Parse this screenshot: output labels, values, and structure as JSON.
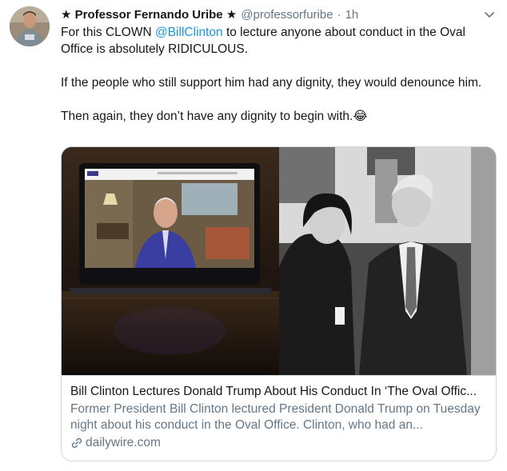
{
  "tweet": {
    "display_name": "★ Professor Fernando Uribe ★",
    "handle": "@professorfuribe",
    "separator": "·",
    "time": "1h",
    "text": {
      "line1_before": "For this CLOWN ",
      "mention": "@BillClinton",
      "line1_after": " to lecture anyone about conduct in the Oval Office is absolutely RIDICULOUS.",
      "paragraph2": "If the people who still support him had any dignity, they would denounce him.",
      "paragraph3": "Then again, they don’t have any dignity to begin with.😂"
    }
  },
  "card": {
    "title": "Bill Clinton Lectures Donald Trump About His Conduct In ‘The Oval Offic...",
    "description": "Former President Bill Clinton lectured President Donald Trump on Tuesday night about his conduct in the Oval Office. Clinton, who had an...",
    "domain": "dailywire.com"
  },
  "icons": {
    "caret": "chevron-down-icon",
    "link": "link-icon"
  },
  "colors": {
    "link": "#1b95e0",
    "secondary_text": "#657786",
    "border": "#ccd6dd"
  }
}
